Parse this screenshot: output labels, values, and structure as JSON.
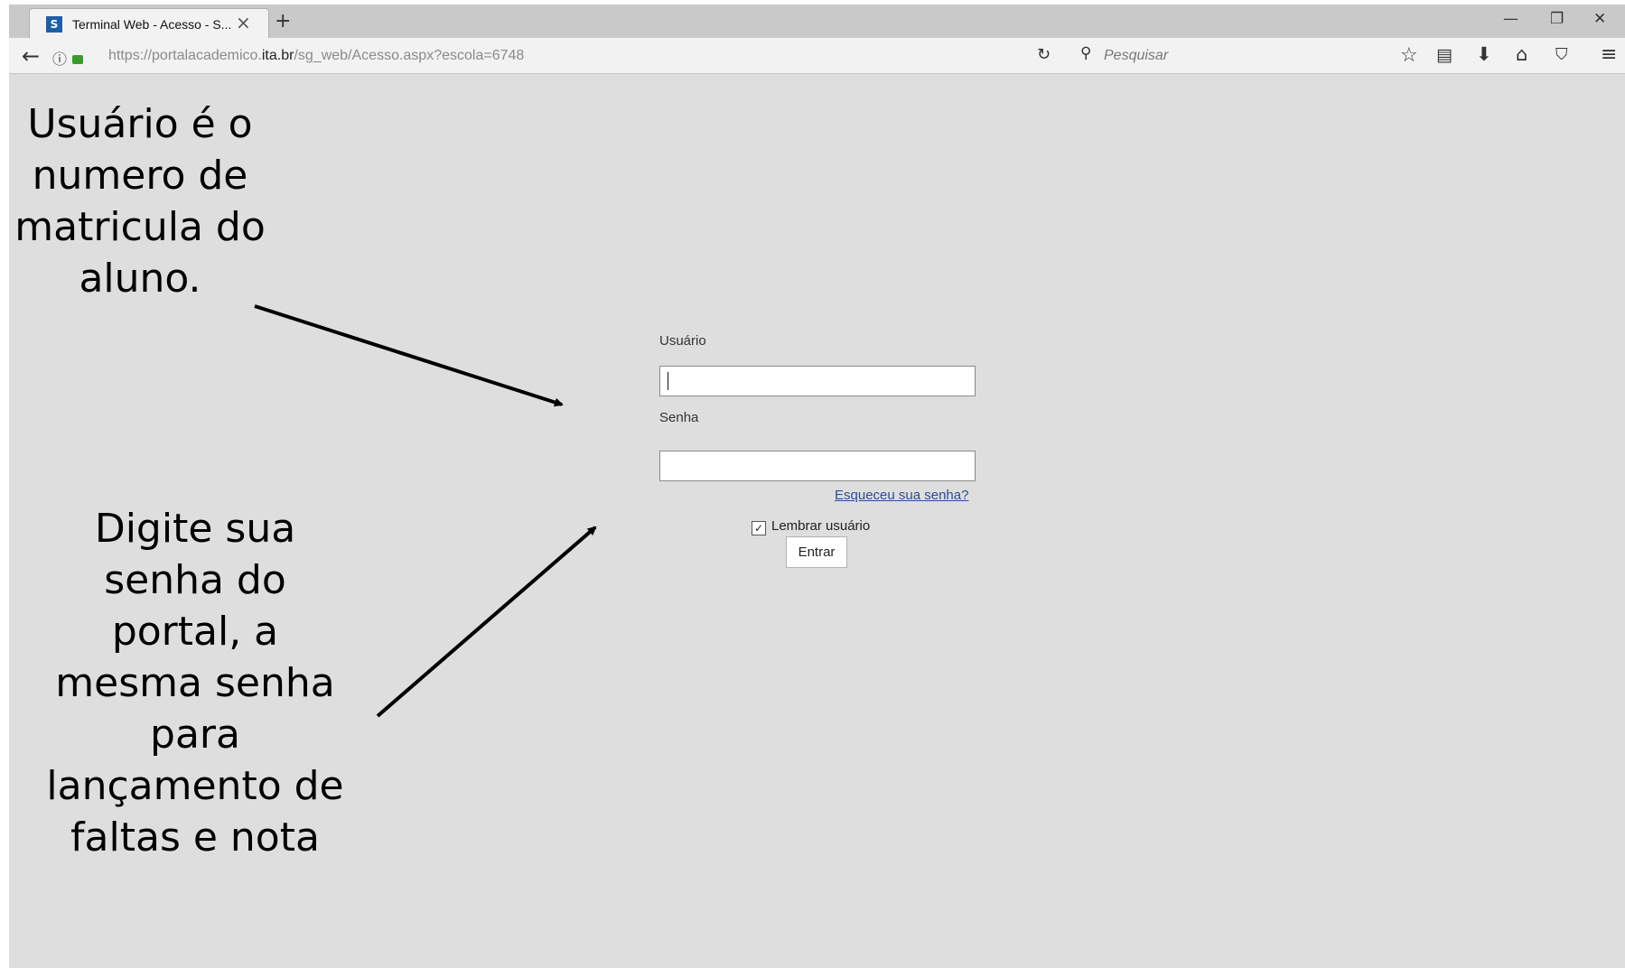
{
  "browser": {
    "tab_title": "Terminal Web - Acesso - S...",
    "tab_favicon_letter": "S",
    "url_prefix": "https://portalacademico.",
    "url_domain": "ita.br",
    "url_path": "/sg_web/Acesso.aspx?escola=6748",
    "search_placeholder": "Pesquisar"
  },
  "login": {
    "user_label": "Usuário",
    "password_label": "Senha",
    "forgot_link": "Esqueceu sua senha?",
    "remember_label": "Lembrar usuário",
    "remember_checked": true,
    "submit_label": "Entrar"
  },
  "annotations": {
    "user_note": [
      "Usuário é o",
      "numero de",
      "matricula do",
      "aluno."
    ],
    "password_note": [
      "Digite sua",
      "senha do",
      "portal, a",
      "mesma senha",
      "para",
      "lançamento de",
      "faltas e nota"
    ]
  },
  "icons": {
    "back": "back-arrow-icon",
    "info": "info-icon",
    "lock": "lock-icon",
    "reload": "reload-icon",
    "search": "search-icon",
    "bookmark": "star-icon",
    "reader": "reader-icon",
    "download": "download-icon",
    "home": "home-icon",
    "pocket": "pocket-icon",
    "menu": "hamburger-menu-icon"
  },
  "colors": {
    "page_background": "#dedede",
    "link": "#2a4f90",
    "favicon": "#1e5da8"
  }
}
